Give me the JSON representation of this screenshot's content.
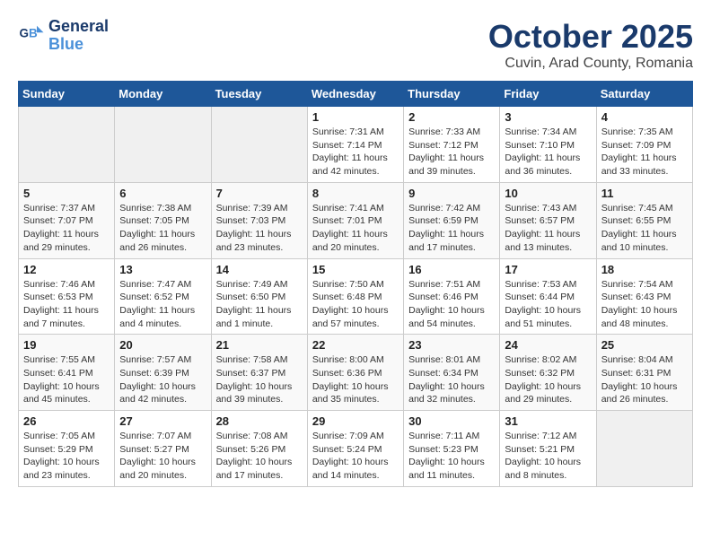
{
  "header": {
    "logo_line1": "General",
    "logo_line2": "Blue",
    "month": "October 2025",
    "location": "Cuvin, Arad County, Romania"
  },
  "weekdays": [
    "Sunday",
    "Monday",
    "Tuesday",
    "Wednesday",
    "Thursday",
    "Friday",
    "Saturday"
  ],
  "weeks": [
    [
      {
        "day": "",
        "info": ""
      },
      {
        "day": "",
        "info": ""
      },
      {
        "day": "",
        "info": ""
      },
      {
        "day": "1",
        "info": "Sunrise: 7:31 AM\nSunset: 7:14 PM\nDaylight: 11 hours\nand 42 minutes."
      },
      {
        "day": "2",
        "info": "Sunrise: 7:33 AM\nSunset: 7:12 PM\nDaylight: 11 hours\nand 39 minutes."
      },
      {
        "day": "3",
        "info": "Sunrise: 7:34 AM\nSunset: 7:10 PM\nDaylight: 11 hours\nand 36 minutes."
      },
      {
        "day": "4",
        "info": "Sunrise: 7:35 AM\nSunset: 7:09 PM\nDaylight: 11 hours\nand 33 minutes."
      }
    ],
    [
      {
        "day": "5",
        "info": "Sunrise: 7:37 AM\nSunset: 7:07 PM\nDaylight: 11 hours\nand 29 minutes."
      },
      {
        "day": "6",
        "info": "Sunrise: 7:38 AM\nSunset: 7:05 PM\nDaylight: 11 hours\nand 26 minutes."
      },
      {
        "day": "7",
        "info": "Sunrise: 7:39 AM\nSunset: 7:03 PM\nDaylight: 11 hours\nand 23 minutes."
      },
      {
        "day": "8",
        "info": "Sunrise: 7:41 AM\nSunset: 7:01 PM\nDaylight: 11 hours\nand 20 minutes."
      },
      {
        "day": "9",
        "info": "Sunrise: 7:42 AM\nSunset: 6:59 PM\nDaylight: 11 hours\nand 17 minutes."
      },
      {
        "day": "10",
        "info": "Sunrise: 7:43 AM\nSunset: 6:57 PM\nDaylight: 11 hours\nand 13 minutes."
      },
      {
        "day": "11",
        "info": "Sunrise: 7:45 AM\nSunset: 6:55 PM\nDaylight: 11 hours\nand 10 minutes."
      }
    ],
    [
      {
        "day": "12",
        "info": "Sunrise: 7:46 AM\nSunset: 6:53 PM\nDaylight: 11 hours\nand 7 minutes."
      },
      {
        "day": "13",
        "info": "Sunrise: 7:47 AM\nSunset: 6:52 PM\nDaylight: 11 hours\nand 4 minutes."
      },
      {
        "day": "14",
        "info": "Sunrise: 7:49 AM\nSunset: 6:50 PM\nDaylight: 11 hours\nand 1 minute."
      },
      {
        "day": "15",
        "info": "Sunrise: 7:50 AM\nSunset: 6:48 PM\nDaylight: 10 hours\nand 57 minutes."
      },
      {
        "day": "16",
        "info": "Sunrise: 7:51 AM\nSunset: 6:46 PM\nDaylight: 10 hours\nand 54 minutes."
      },
      {
        "day": "17",
        "info": "Sunrise: 7:53 AM\nSunset: 6:44 PM\nDaylight: 10 hours\nand 51 minutes."
      },
      {
        "day": "18",
        "info": "Sunrise: 7:54 AM\nSunset: 6:43 PM\nDaylight: 10 hours\nand 48 minutes."
      }
    ],
    [
      {
        "day": "19",
        "info": "Sunrise: 7:55 AM\nSunset: 6:41 PM\nDaylight: 10 hours\nand 45 minutes."
      },
      {
        "day": "20",
        "info": "Sunrise: 7:57 AM\nSunset: 6:39 PM\nDaylight: 10 hours\nand 42 minutes."
      },
      {
        "day": "21",
        "info": "Sunrise: 7:58 AM\nSunset: 6:37 PM\nDaylight: 10 hours\nand 39 minutes."
      },
      {
        "day": "22",
        "info": "Sunrise: 8:00 AM\nSunset: 6:36 PM\nDaylight: 10 hours\nand 35 minutes."
      },
      {
        "day": "23",
        "info": "Sunrise: 8:01 AM\nSunset: 6:34 PM\nDaylight: 10 hours\nand 32 minutes."
      },
      {
        "day": "24",
        "info": "Sunrise: 8:02 AM\nSunset: 6:32 PM\nDaylight: 10 hours\nand 29 minutes."
      },
      {
        "day": "25",
        "info": "Sunrise: 8:04 AM\nSunset: 6:31 PM\nDaylight: 10 hours\nand 26 minutes."
      }
    ],
    [
      {
        "day": "26",
        "info": "Sunrise: 7:05 AM\nSunset: 5:29 PM\nDaylight: 10 hours\nand 23 minutes."
      },
      {
        "day": "27",
        "info": "Sunrise: 7:07 AM\nSunset: 5:27 PM\nDaylight: 10 hours\nand 20 minutes."
      },
      {
        "day": "28",
        "info": "Sunrise: 7:08 AM\nSunset: 5:26 PM\nDaylight: 10 hours\nand 17 minutes."
      },
      {
        "day": "29",
        "info": "Sunrise: 7:09 AM\nSunset: 5:24 PM\nDaylight: 10 hours\nand 14 minutes."
      },
      {
        "day": "30",
        "info": "Sunrise: 7:11 AM\nSunset: 5:23 PM\nDaylight: 10 hours\nand 11 minutes."
      },
      {
        "day": "31",
        "info": "Sunrise: 7:12 AM\nSunset: 5:21 PM\nDaylight: 10 hours\nand 8 minutes."
      },
      {
        "day": "",
        "info": ""
      }
    ]
  ]
}
